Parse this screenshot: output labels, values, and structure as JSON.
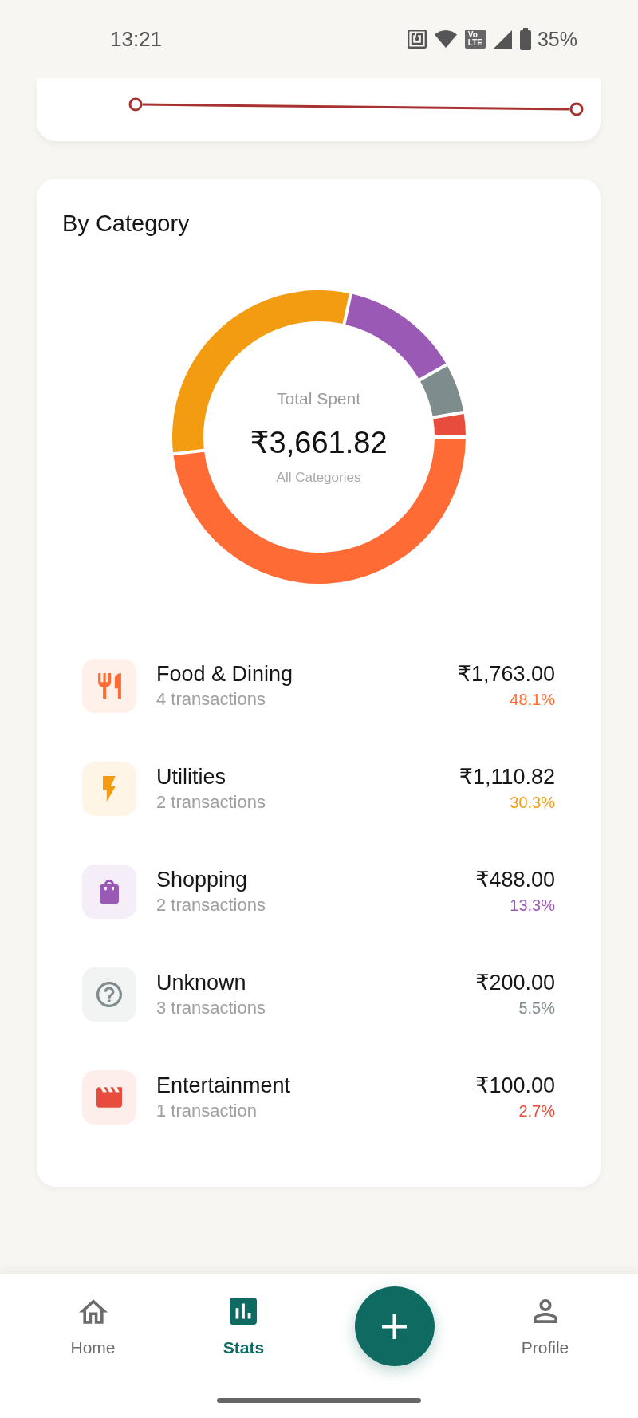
{
  "status_bar": {
    "time": "13:21",
    "network_badge": "Vo LTE",
    "battery": "35%"
  },
  "trend_chart": {
    "kind": "line"
  },
  "category_card": {
    "title": "By Category",
    "chart_data": {
      "type": "donut",
      "categories": [
        "Food & Dining",
        "Utilities",
        "Shopping",
        "Unknown",
        "Entertainment"
      ],
      "values": [
        48.1,
        30.3,
        13.3,
        5.5,
        2.7
      ]
    },
    "center": {
      "label": "Total Spent",
      "total": "₹3,661.82",
      "caption": "All Categories"
    },
    "categories": [
      {
        "kind": "food",
        "count": "4 transactions",
        "amount": "₹1,763.00",
        "percent": "48.1%",
        "color": "#ff6b35"
      },
      {
        "kind": "utilities",
        "count": "2 transactions",
        "amount": "₹1,110.82",
        "percent": "30.3%",
        "color": "#f39c12"
      },
      {
        "kind": "shopping",
        "count": "2 transactions",
        "amount": "₹488.00",
        "percent": "13.3%",
        "color": "#9b59b6"
      },
      {
        "kind": "unknown",
        "count": "3 transactions",
        "amount": "₹200.00",
        "percent": "5.5%",
        "color": "#7f8c8d"
      },
      {
        "kind": "entertainment",
        "count": "1 transaction",
        "amount": "₹100.00",
        "percent": "2.7%",
        "color": "#e74c3c"
      }
    ]
  },
  "bottom_nav": {
    "items": [
      {
        "kind": "home",
        "label": "Home",
        "selected": false
      },
      {
        "kind": "stats",
        "label": "Stats",
        "selected": true
      },
      {
        "kind": "profile",
        "label": "Profile",
        "selected": false
      }
    ],
    "fab": {
      "kind": "add"
    }
  }
}
